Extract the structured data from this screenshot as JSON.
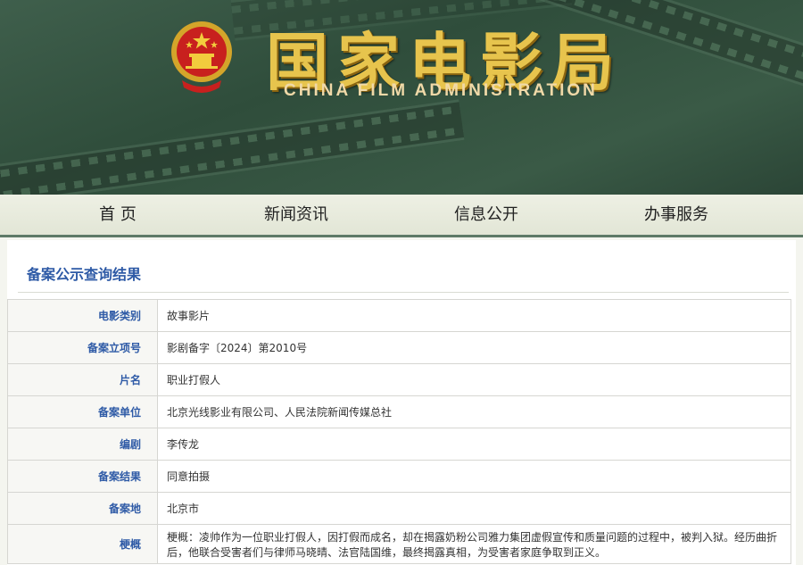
{
  "header": {
    "title_cn": "国家电影局",
    "title_en": "CHINA FILM ADMINISTRATION",
    "emblem_icon": "national-emblem-icon"
  },
  "nav": {
    "items": [
      {
        "label": "首 页"
      },
      {
        "label": "新闻资讯"
      },
      {
        "label": "信息公开"
      },
      {
        "label": "办事服务"
      }
    ]
  },
  "result": {
    "section_title": "备案公示查询结果",
    "rows": [
      {
        "label": "电影类别",
        "value": "故事影片"
      },
      {
        "label": "备案立项号",
        "value": "影剧备字〔2024〕第2010号"
      },
      {
        "label": "片名",
        "value": "职业打假人"
      },
      {
        "label": "备案单位",
        "value": "北京光线影业有限公司、人民法院新闻传媒总社"
      },
      {
        "label": "编剧",
        "value": "李传龙"
      },
      {
        "label": "备案结果",
        "value": "同意拍摄"
      },
      {
        "label": "备案地",
        "value": "北京市"
      },
      {
        "label": "梗概",
        "value": "梗概：凌帅作为一位职业打假人，因打假而成名，却在揭露奶粉公司雅力集团虚假宣传和质量问题的过程中，被判入狱。经历曲折后，他联合受害者们与律师马晓晴、法官陆国维，最终揭露真相，为受害者家庭争取到正义。"
      }
    ]
  },
  "colors": {
    "banner_green": "#3f5f4c",
    "gold": "#e7c44d",
    "label_blue": "#2e5aa6"
  }
}
